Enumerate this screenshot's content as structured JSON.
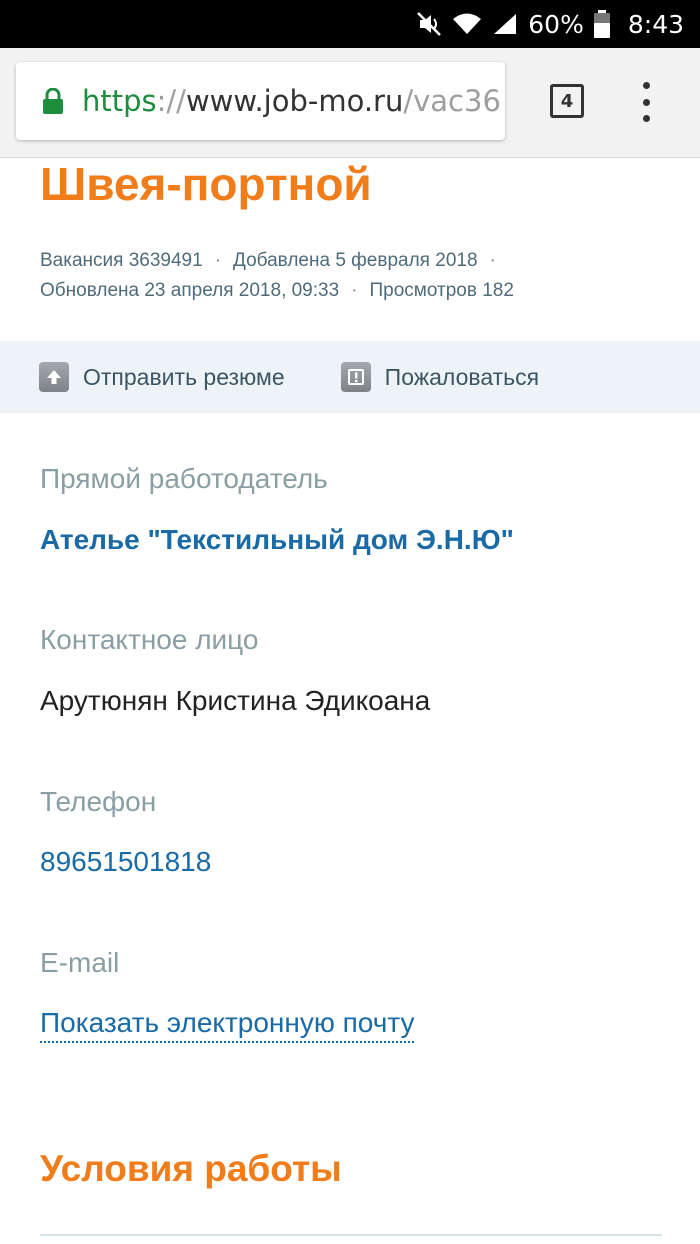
{
  "status_bar": {
    "battery": "60%",
    "time": "8:43",
    "icons": [
      "mute-icon",
      "wifi-icon",
      "signal-icon",
      "battery-icon"
    ]
  },
  "browser": {
    "url_scheme": "https",
    "url_separator": "://",
    "url_domain": "www.job-mo.ru",
    "url_path": "/vac36",
    "tab_count": "4"
  },
  "vacancy": {
    "title": "Швея-портной",
    "meta": {
      "number": "Вакансия 3639491",
      "added": "Добавлена 5 февраля 2018",
      "updated": "Обновлена 23 апреля 2018, 09:33",
      "views": "Просмотров 182",
      "separator": "·"
    },
    "actions": {
      "send_resume": "Отправить резюме",
      "complain": "Пожаловаться"
    },
    "employer_label": "Прямой работодатель",
    "employer_name": "Ателье \"Текстильный дом Э.Н.Ю\"",
    "contact_label": "Контактное лицо",
    "contact_name": "Арутюнян Кристина Эдикоана",
    "phone_label": "Телефон",
    "phone": "89651501818",
    "email_label": "E-mail",
    "email_link": "Показать электронную почту",
    "conditions_title": "Условия работы"
  },
  "colors": {
    "accent_orange": "#f07c1a",
    "link_blue": "#1a6aa6",
    "label_gray": "#8a9ea3",
    "action_bar_bg": "#eef3f8",
    "url_secure_green": "#1e8e3e"
  }
}
